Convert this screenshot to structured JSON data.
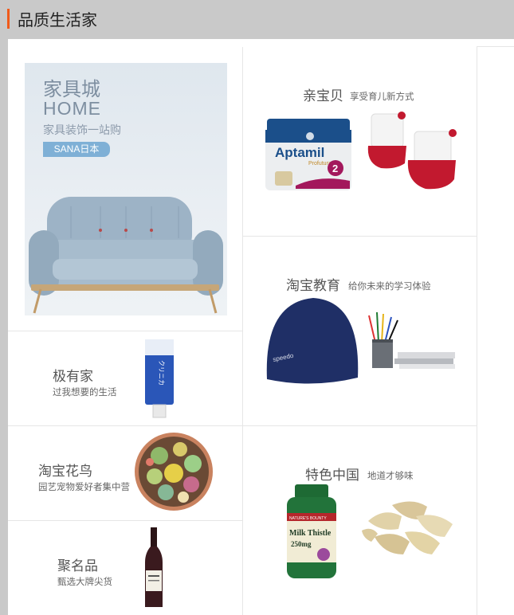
{
  "header": {
    "title": "品质生活家"
  },
  "home_banner": {
    "title_cn": "家具城",
    "title_en": "HOME",
    "subtitle": "家具装饰一站购",
    "badge": "SANA日本"
  },
  "tiles": [
    {
      "title": "亲宝贝",
      "subtitle": "享受育儿新方式",
      "product_text": "Aptamil",
      "product_sub": "Profutura",
      "product_num": "2"
    },
    {
      "title": "淘宝教育",
      "subtitle": "给你未来的学习体验",
      "product_text": "speedo"
    },
    {
      "title": "极有家",
      "subtitle": "过我想要的生活",
      "product_text": "クリニカ"
    },
    {
      "title": "淘宝花鸟",
      "subtitle": "园艺宠物爱好者集中营"
    },
    {
      "title": "特色中国",
      "subtitle": "地道才够味",
      "product_brand": "NATURE'S BOUNTY",
      "product_text": "Milk Thistle",
      "product_sub": "250mg"
    },
    {
      "title": "聚名品",
      "subtitle": "甄选大牌尖货"
    }
  ],
  "colors": {
    "header_bg": "#c9c9c9",
    "accent_bar": "#f05a1a"
  }
}
